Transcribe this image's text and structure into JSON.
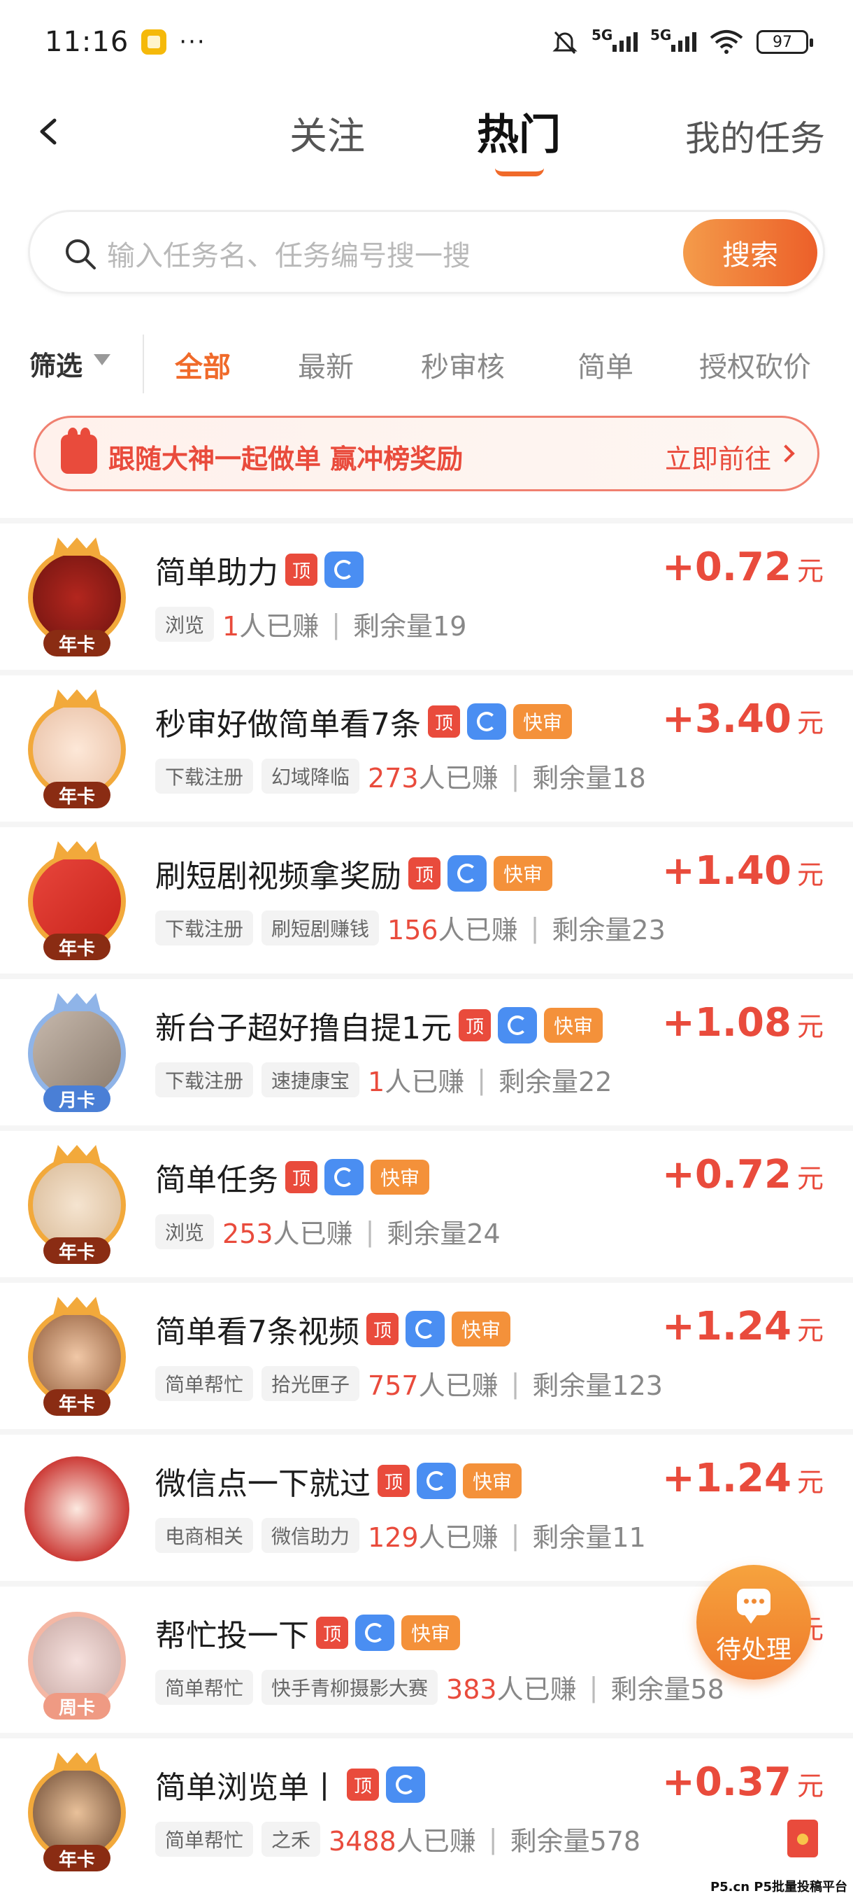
{
  "status_bar": {
    "time": "11:16",
    "dots": "···",
    "signal1": "5G",
    "signal2": "5G",
    "battery": "97"
  },
  "header": {
    "tabs": [
      {
        "label": "关注"
      },
      {
        "label": "热门"
      },
      {
        "label": "我的任务"
      }
    ],
    "active_tab": "热门"
  },
  "search": {
    "placeholder": "输入任务名、任务编号搜一搜",
    "button": "搜索"
  },
  "filter": {
    "label": "筛选",
    "categories": [
      "全部",
      "最新",
      "秒审核",
      "简单",
      "授权砍价"
    ],
    "active": "全部"
  },
  "banner": {
    "text": "跟随大神一起做单 赢冲榜奖励",
    "link": "立即前往"
  },
  "tasks": [
    {
      "title": "简单助力",
      "tags": [
        "顶",
        "refresh"
      ],
      "chips": [
        "浏览"
      ],
      "earned_count": "1",
      "earned_suffix": "人已赚",
      "remaining": "剩余量19",
      "amount": "+0.72",
      "unit": "元",
      "badge": "年卡"
    },
    {
      "title": "秒审好做简单看7条",
      "tags": [
        "顶",
        "refresh",
        "快审"
      ],
      "chips": [
        "下载注册",
        "幻域降临"
      ],
      "earned_count": "273",
      "earned_suffix": "人已赚",
      "remaining": "剩余量18",
      "amount": "+3.40",
      "unit": "元",
      "badge": "年卡"
    },
    {
      "title": "刷短剧视频拿奖励",
      "tags": [
        "顶",
        "refresh",
        "快审"
      ],
      "chips": [
        "下载注册",
        "刷短剧赚钱"
      ],
      "earned_count": "156",
      "earned_suffix": "人已赚",
      "remaining": "剩余量23",
      "amount": "+1.40",
      "unit": "元",
      "badge": "年卡"
    },
    {
      "title": "新台子超好撸自提1元",
      "tags": [
        "顶",
        "refresh",
        "快审"
      ],
      "chips": [
        "下载注册",
        "速捷康宝"
      ],
      "earned_count": "1",
      "earned_suffix": "人已赚",
      "remaining": "剩余量22",
      "amount": "+1.08",
      "unit": "元",
      "badge": "月卡"
    },
    {
      "title": "简单任务",
      "tags": [
        "顶",
        "refresh",
        "快审"
      ],
      "chips": [
        "浏览"
      ],
      "earned_count": "253",
      "earned_suffix": "人已赚",
      "remaining": "剩余量24",
      "amount": "+0.72",
      "unit": "元",
      "badge": "年卡"
    },
    {
      "title": "简单看7条视频",
      "tags": [
        "顶",
        "refresh",
        "快审"
      ],
      "chips": [
        "简单帮忙",
        "拾光匣子"
      ],
      "earned_count": "757",
      "earned_suffix": "人已赚",
      "remaining": "剩余量123",
      "amount": "+1.24",
      "unit": "元",
      "badge": "年卡"
    },
    {
      "title": "微信点一下就过",
      "tags": [
        "顶",
        "refresh",
        "快审"
      ],
      "chips": [
        "电商相关",
        "微信助力"
      ],
      "earned_count": "129",
      "earned_suffix": "人已赚",
      "remaining": "剩余量11",
      "amount": "+1.24",
      "unit": "元",
      "badge": ""
    },
    {
      "title": "帮忙投一下",
      "tags": [
        "顶",
        "refresh",
        "快审"
      ],
      "chips": [
        "简单帮忙",
        "快手青柳摄影大赛"
      ],
      "earned_count": "383",
      "earned_suffix": "人已赚",
      "remaining": "剩余量58",
      "amount": "",
      "unit": "元",
      "badge": "周卡"
    },
    {
      "title": "简单浏览单丨",
      "tags": [
        "顶",
        "refresh"
      ],
      "chips": [
        "简单帮忙",
        "之禾"
      ],
      "earned_count": "3488",
      "earned_suffix": "人已赚",
      "remaining": "剩余量578",
      "amount": "+0.37",
      "unit": "元",
      "badge": "年卡"
    }
  ],
  "tag_labels": {
    "top": "顶",
    "fast": "快审"
  },
  "float_button": {
    "label": "待处理"
  },
  "watermark": "P5.cn P5批量投稿平台",
  "colors": {
    "accent": "#f06a2a",
    "price": "#e94b3c",
    "refresh": "#4a8ef2",
    "fast": "#f4913a"
  }
}
